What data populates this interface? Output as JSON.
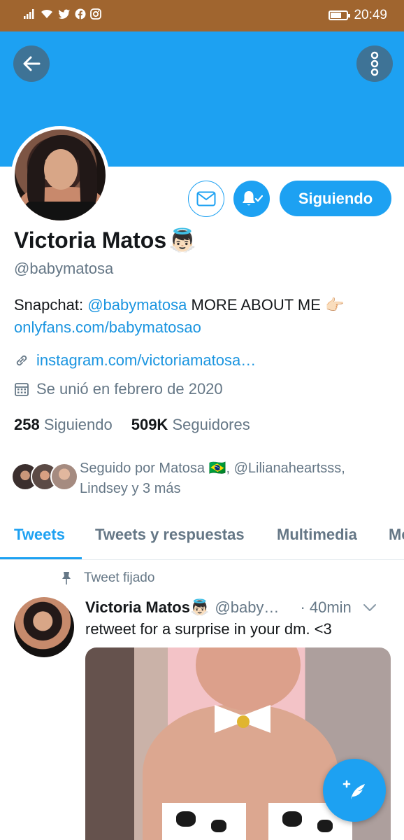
{
  "statusbar": {
    "time": "20:49",
    "icons": [
      "signal-icon",
      "wifi-icon",
      "twitter-icon",
      "facebook-icon",
      "instagram-icon",
      "battery-icon"
    ],
    "battery_level": 0.6
  },
  "profile": {
    "name": "Victoria Matos",
    "name_emoji": "👼🏻",
    "handle": "@babymatosa",
    "bio_prefix": "Snapchat: ",
    "bio_snap_handle": "@babymatosa",
    "bio_middle": " MORE ABOUT ME ",
    "bio_emoji": "👉🏻",
    "bio_link": "onlyfans.com/babymatosao",
    "website": "instagram.com/victoriamatosa…",
    "joined": "Se unió en febrero de 2020",
    "following_count": "258",
    "following_label": "Siguiendo",
    "followers_count": "509K",
    "followers_label": "Seguidores",
    "followed_by_line1": "Seguido por Matosa 🇧🇷, @Lilianaheartsss,",
    "followed_by_line2": "Lindsey y 3 más"
  },
  "actions": {
    "following_button": "Siguiendo"
  },
  "tabs": [
    {
      "label": "Tweets",
      "active": true
    },
    {
      "label": "Tweets y respuestas",
      "active": false
    },
    {
      "label": "Multimedia",
      "active": false
    },
    {
      "label": "Me",
      "active": false
    }
  ],
  "tweet": {
    "pinned_label": "Tweet fijado",
    "author": "Victoria Matos",
    "author_emoji": "👼🏻",
    "handle": "@baby…",
    "time": "· 40min",
    "text": "retweet for a surprise in your dm. <3"
  },
  "colors": {
    "accent": "#1da1f2",
    "statusbar": "#a0652f",
    "secondary_text": "#657786",
    "link": "#1b95e0"
  }
}
